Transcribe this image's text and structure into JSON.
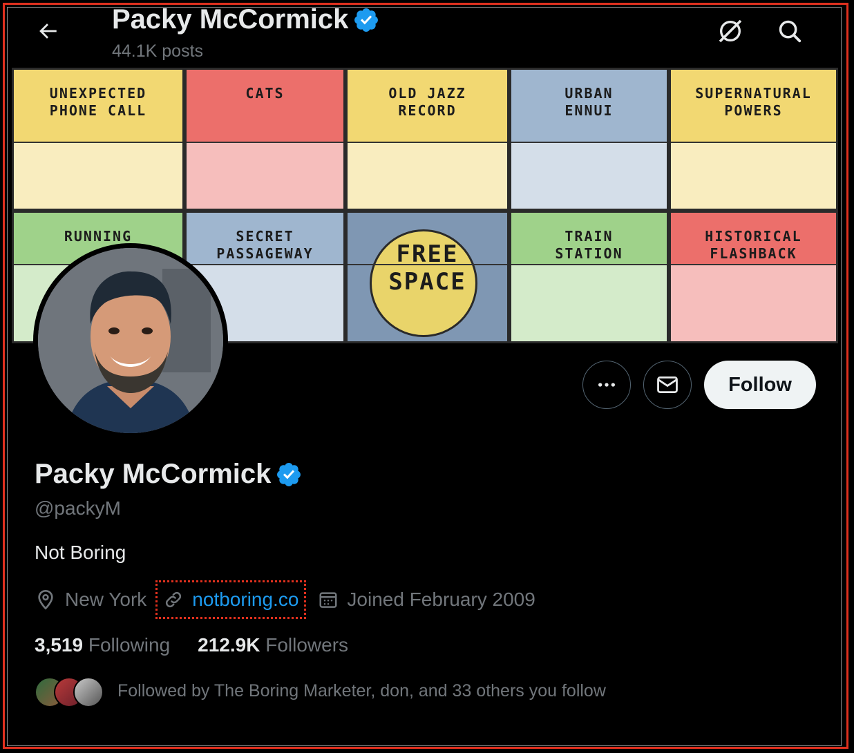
{
  "header": {
    "name": "Packy McCormick",
    "posts": "44.1K posts"
  },
  "banner": {
    "panels": [
      {
        "label": "UNEXPECTED\nPHONE CALL",
        "color": "#f2d872"
      },
      {
        "label": "CATS",
        "color": "#ec6f6b"
      },
      {
        "label": "OLD JAZZ\nRECORD",
        "color": "#f2d872"
      },
      {
        "label": "URBAN\nENNUI",
        "color": "#9fb6cf"
      },
      {
        "label": "SUPERNATURAL\nPOWERS",
        "color": "#f2d872"
      },
      {
        "label": "RUNNING",
        "color": "#9fd28a"
      },
      {
        "label": "SECRET\nPASSAGEWAY",
        "color": "#9fb6cf"
      },
      {
        "label": "FREE\nSPACE",
        "color": "#7f97b3"
      },
      {
        "label": "TRAIN\nSTATION",
        "color": "#9fd28a"
      },
      {
        "label": "HISTORICAL\nFLASHBACK",
        "color": "#ec6f6b"
      }
    ]
  },
  "profile": {
    "display_name": "Packy McCormick",
    "handle": "@packyM",
    "bio": "Not Boring",
    "location": "New York",
    "website": "notboring.co",
    "joined": "Joined February 2009",
    "following_count": "3,519",
    "following_label": "Following",
    "followers_count": "212.9K",
    "followers_label": "Followers",
    "followed_by": "Followed by The Boring Marketer, don, and 33 others you follow"
  },
  "actions": {
    "follow_label": "Follow"
  },
  "colors": {
    "accent": "#1d9bf0",
    "verified": "#1d9bf0",
    "highlight": "#e0301e"
  }
}
